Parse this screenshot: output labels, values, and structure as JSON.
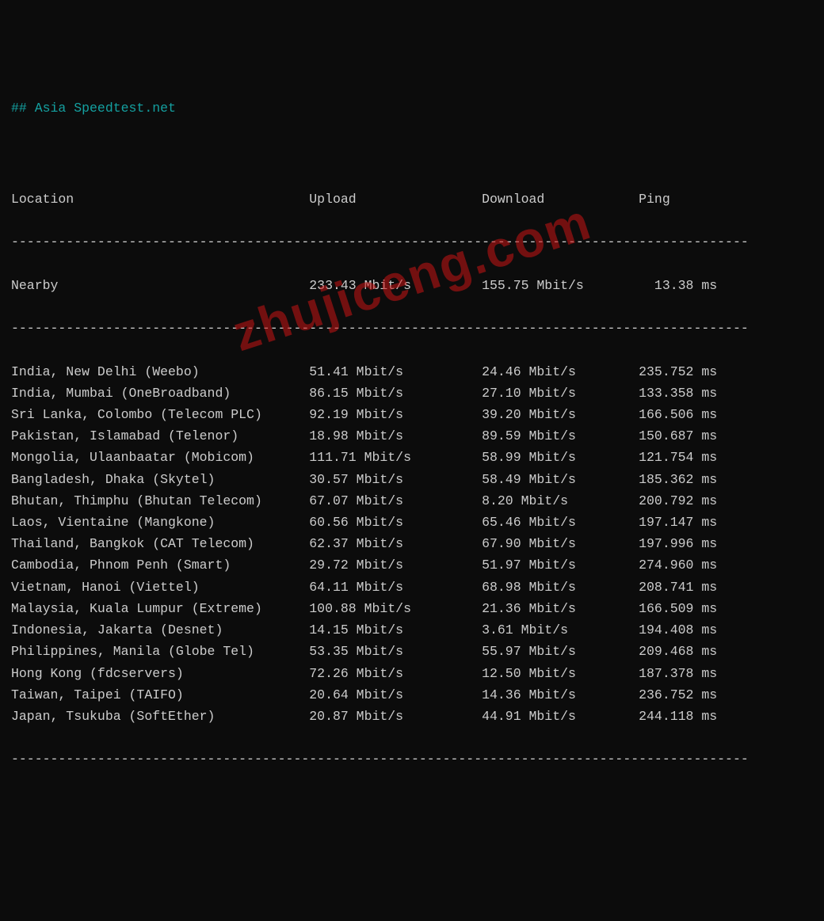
{
  "title": "## Asia Speedtest.net",
  "headers": {
    "location": "Location",
    "upload": "Upload",
    "download": "Download",
    "ping": "Ping"
  },
  "divider": "----------------------------------------------------------------------------------------------",
  "nearby": {
    "location": "Nearby",
    "upload": "233.43 Mbit/s",
    "download": "155.75 Mbit/s",
    "ping": "13.38 ms"
  },
  "rows": [
    {
      "location": "India, New Delhi (Weebo)",
      "upload": "51.41 Mbit/s",
      "download": "24.46 Mbit/s",
      "ping": "235.752 ms"
    },
    {
      "location": "India, Mumbai (OneBroadband)",
      "upload": "86.15 Mbit/s",
      "download": "27.10 Mbit/s",
      "ping": "133.358 ms"
    },
    {
      "location": "Sri Lanka, Colombo (Telecom PLC)",
      "upload": "92.19 Mbit/s",
      "download": "39.20 Mbit/s",
      "ping": "166.506 ms"
    },
    {
      "location": "Pakistan, Islamabad (Telenor)",
      "upload": "18.98 Mbit/s",
      "download": "89.59 Mbit/s",
      "ping": "150.687 ms"
    },
    {
      "location": "Mongolia, Ulaanbaatar (Mobicom)",
      "upload": "111.71 Mbit/s",
      "download": "58.99 Mbit/s",
      "ping": "121.754 ms"
    },
    {
      "location": "Bangladesh, Dhaka (Skytel)",
      "upload": "30.57 Mbit/s",
      "download": "58.49 Mbit/s",
      "ping": "185.362 ms"
    },
    {
      "location": "Bhutan, Thimphu (Bhutan Telecom)",
      "upload": "67.07 Mbit/s",
      "download": "8.20 Mbit/s",
      "ping": "200.792 ms"
    },
    {
      "location": "Laos, Vientaine (Mangkone)",
      "upload": "60.56 Mbit/s",
      "download": "65.46 Mbit/s",
      "ping": "197.147 ms"
    },
    {
      "location": "Thailand, Bangkok (CAT Telecom)",
      "upload": "62.37 Mbit/s",
      "download": "67.90 Mbit/s",
      "ping": "197.996 ms"
    },
    {
      "location": "Cambodia, Phnom Penh (Smart)",
      "upload": "29.72 Mbit/s",
      "download": "51.97 Mbit/s",
      "ping": "274.960 ms"
    },
    {
      "location": "Vietnam, Hanoi (Viettel)",
      "upload": "64.11 Mbit/s",
      "download": "68.98 Mbit/s",
      "ping": "208.741 ms"
    },
    {
      "location": "Malaysia, Kuala Lumpur (Extreme)",
      "upload": "100.88 Mbit/s",
      "download": "21.36 Mbit/s",
      "ping": "166.509 ms"
    },
    {
      "location": "Indonesia, Jakarta (Desnet)",
      "upload": "14.15 Mbit/s",
      "download": "3.61 Mbit/s",
      "ping": "194.408 ms"
    },
    {
      "location": "Philippines, Manila (Globe Tel)",
      "upload": "53.35 Mbit/s",
      "download": "55.97 Mbit/s",
      "ping": "209.468 ms"
    },
    {
      "location": "Hong Kong (fdcservers)",
      "upload": "72.26 Mbit/s",
      "download": "12.50 Mbit/s",
      "ping": "187.378 ms"
    },
    {
      "location": "Taiwan, Taipei (TAIFO)",
      "upload": "20.64 Mbit/s",
      "download": "14.36 Mbit/s",
      "ping": "236.752 ms"
    },
    {
      "location": "Japan, Tsukuba (SoftEther)",
      "upload": "20.87 Mbit/s",
      "download": "44.91 Mbit/s",
      "ping": "244.118 ms"
    }
  ],
  "watermark": "zhujiceng.com",
  "colwidths": {
    "location": 38,
    "upload": 22,
    "download": 20
  }
}
